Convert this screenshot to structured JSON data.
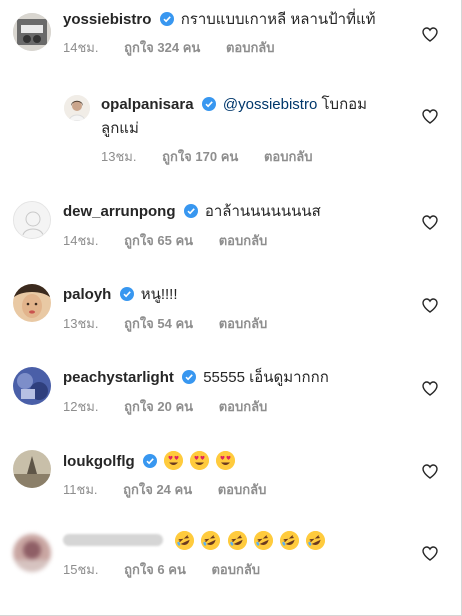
{
  "comments": [
    {
      "username": "yossiebistro",
      "text": "กราบแบบเกาหลี หลานป้าที่แท้",
      "time": "14ชม.",
      "likes": "ถูกใจ 324 คน",
      "reply": "ตอบกลับ"
    },
    {
      "username": "opalpanisara",
      "mention": "@yossiebistro",
      "text": "โบกอม",
      "text2": "ลูกแม่",
      "time": "13ชม.",
      "likes": "ถูกใจ 170 คน",
      "reply": "ตอบกลับ"
    },
    {
      "username": "dew_arrunpong",
      "text": "อาล้านนนนนนนส",
      "time": "14ชม.",
      "likes": "ถูกใจ 65 คน",
      "reply": "ตอบกลับ"
    },
    {
      "username": "paloyh",
      "text": "หนู!!!!",
      "time": "13ชม.",
      "likes": "ถูกใจ 54 คน",
      "reply": "ตอบกลับ"
    },
    {
      "username": "peachystarlight",
      "text": "55555 เอ็นดูมากกก",
      "time": "12ชม.",
      "likes": "ถูกใจ 20 คน",
      "reply": "ตอบกลับ"
    },
    {
      "username": "loukgolflg",
      "emojis": [
        "heart-eyes-emoji",
        "heart-eyes-emoji",
        "heart-eyes-emoji"
      ],
      "time": "11ชม.",
      "likes": "ถูกใจ 24 คน",
      "reply": "ตอบกลับ"
    },
    {
      "username": "",
      "emojis": [
        "rofl-emoji",
        "rofl-emoji",
        "rofl-emoji",
        "rofl-emoji",
        "rofl-emoji",
        "rofl-emoji"
      ],
      "time": "15ชม.",
      "likes": "ถูกใจ 6 คน",
      "reply": "ตอบกลับ"
    }
  ],
  "colors": {
    "verified": "#3897f0",
    "meta": "#8e8e8e",
    "mention": "#00376b",
    "text": "#262626"
  },
  "icons": {
    "like": "heart-outline-icon",
    "verified": "verified-badge-icon"
  }
}
